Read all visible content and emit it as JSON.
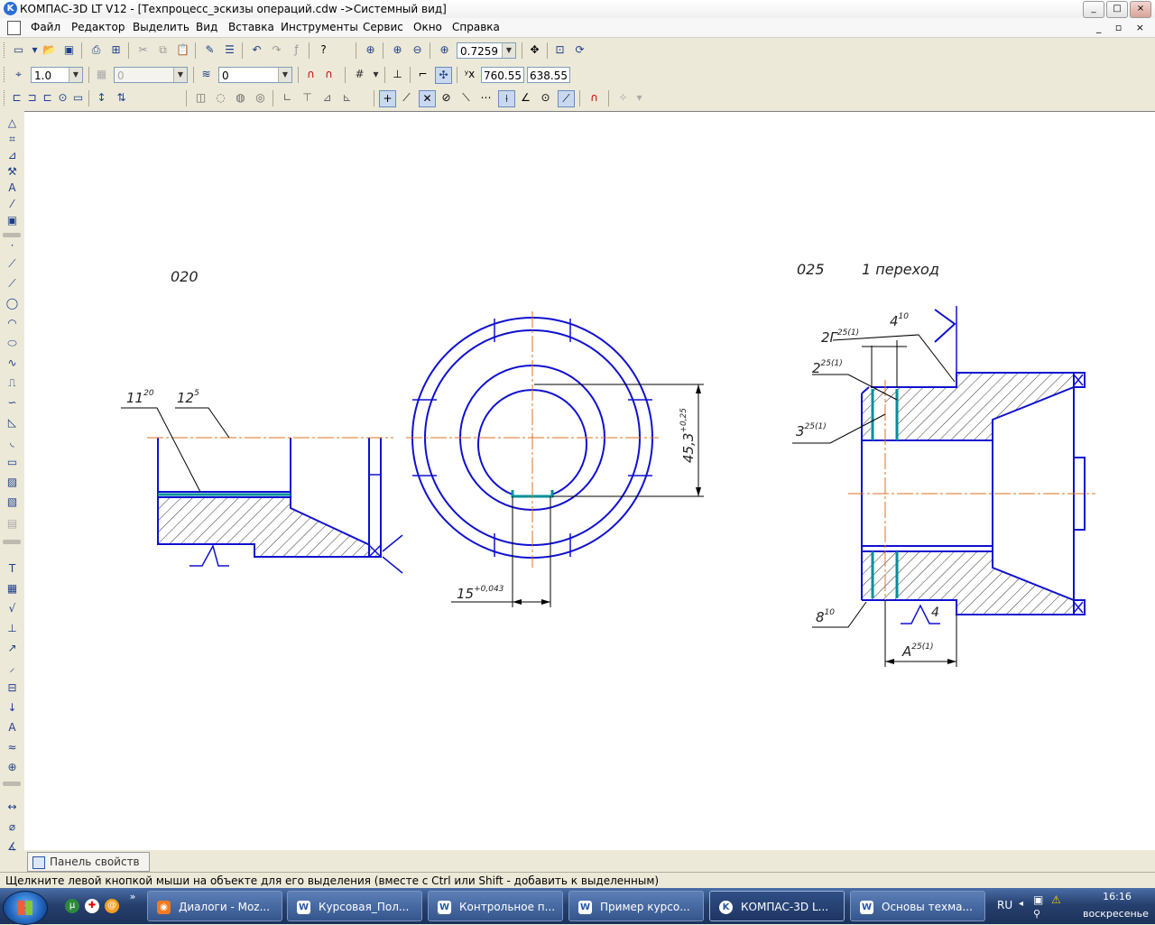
{
  "window": {
    "title": "КОМПАС-3D LT V12 - [Техпроцесс_эскизы операций.cdw ->Системный вид]",
    "controls": [
      "_",
      "□",
      "×"
    ]
  },
  "menu": {
    "items": [
      "Файл",
      "Редактор",
      "Выделить",
      "Вид",
      "Вставка",
      "Инструменты",
      "Сервис",
      "Окно",
      "Справка"
    ]
  },
  "toolbar": {
    "zoom": "0.7259",
    "scale": "1.0",
    "layer": "0",
    "style": "0",
    "coord_x": "760.55",
    "coord_y": "638.55"
  },
  "drawing": {
    "op1_label": "020",
    "op2_label": "025",
    "op2_step": "1 переход",
    "rough_11": "11",
    "rough_11_sup": "20",
    "rough_12": "12",
    "rough_12_sup": "5",
    "dim_45": "45,3",
    "dim_45_tol": "+0,25",
    "dim_15": "15",
    "dim_15_tol": "+0,043",
    "ann_2g": "2Г",
    "ann_2g_sup": "25(1)",
    "ann_4": "4",
    "ann_4_sup": "10",
    "ann_2": "2",
    "ann_2_sup": "25(1)",
    "ann_3": "3",
    "ann_3_sup": "25(1)",
    "ann_8": "8",
    "ann_8_sup": "10",
    "ann_a": "A",
    "ann_a_sup": "25(1)",
    "ann_4b": "4"
  },
  "property_panel": {
    "tab": "Панель свойств"
  },
  "status": {
    "text": "Щелкните левой кнопкой мыши на объекте для его выделения (вместе с Ctrl или Shift - добавить к выделенным)"
  },
  "taskbar": {
    "tasks": [
      "Диалоги - Moz...",
      "Курсовая_Пол...",
      "Контрольное п...",
      "Пример курсо...",
      "КОМПАС-3D L...",
      "Основы техма..."
    ],
    "lang": "RU",
    "time": "16:16",
    "day": "воскресенье"
  },
  "colors": {
    "contour": "#1010d0",
    "axis": "#e07020",
    "highlight": "#00909a",
    "hatch": "#000000"
  }
}
